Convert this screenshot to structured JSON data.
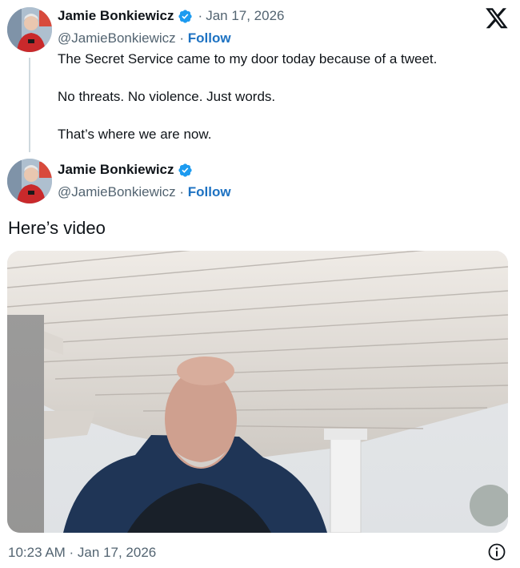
{
  "tweets": [
    {
      "author_name": "Jamie Bonkiewicz",
      "handle": "@JamieBonkiewicz",
      "separator": "·",
      "follow_label": "Follow",
      "date_prefix": "·",
      "date": "Jan 17, 2026",
      "lines": [
        "The Secret Service came to my door today because of a tweet.",
        "No threats. No violence. Just words.",
        "That’s where we are now."
      ]
    },
    {
      "author_name": "Jamie Bonkiewicz",
      "handle": "@JamieBonkiewicz",
      "separator": "·",
      "follow_label": "Follow",
      "text": "Here’s video"
    }
  ],
  "footer": {
    "timestamp": "10:23 AM · Jan 17, 2026"
  },
  "icons": {
    "logo": "x-logo-icon",
    "verified": "verified-badge-icon",
    "info": "info-icon"
  },
  "colors": {
    "verified_blue": "#1d9bf0",
    "follow_blue": "#1d72c2",
    "secondary_text": "#536471"
  }
}
